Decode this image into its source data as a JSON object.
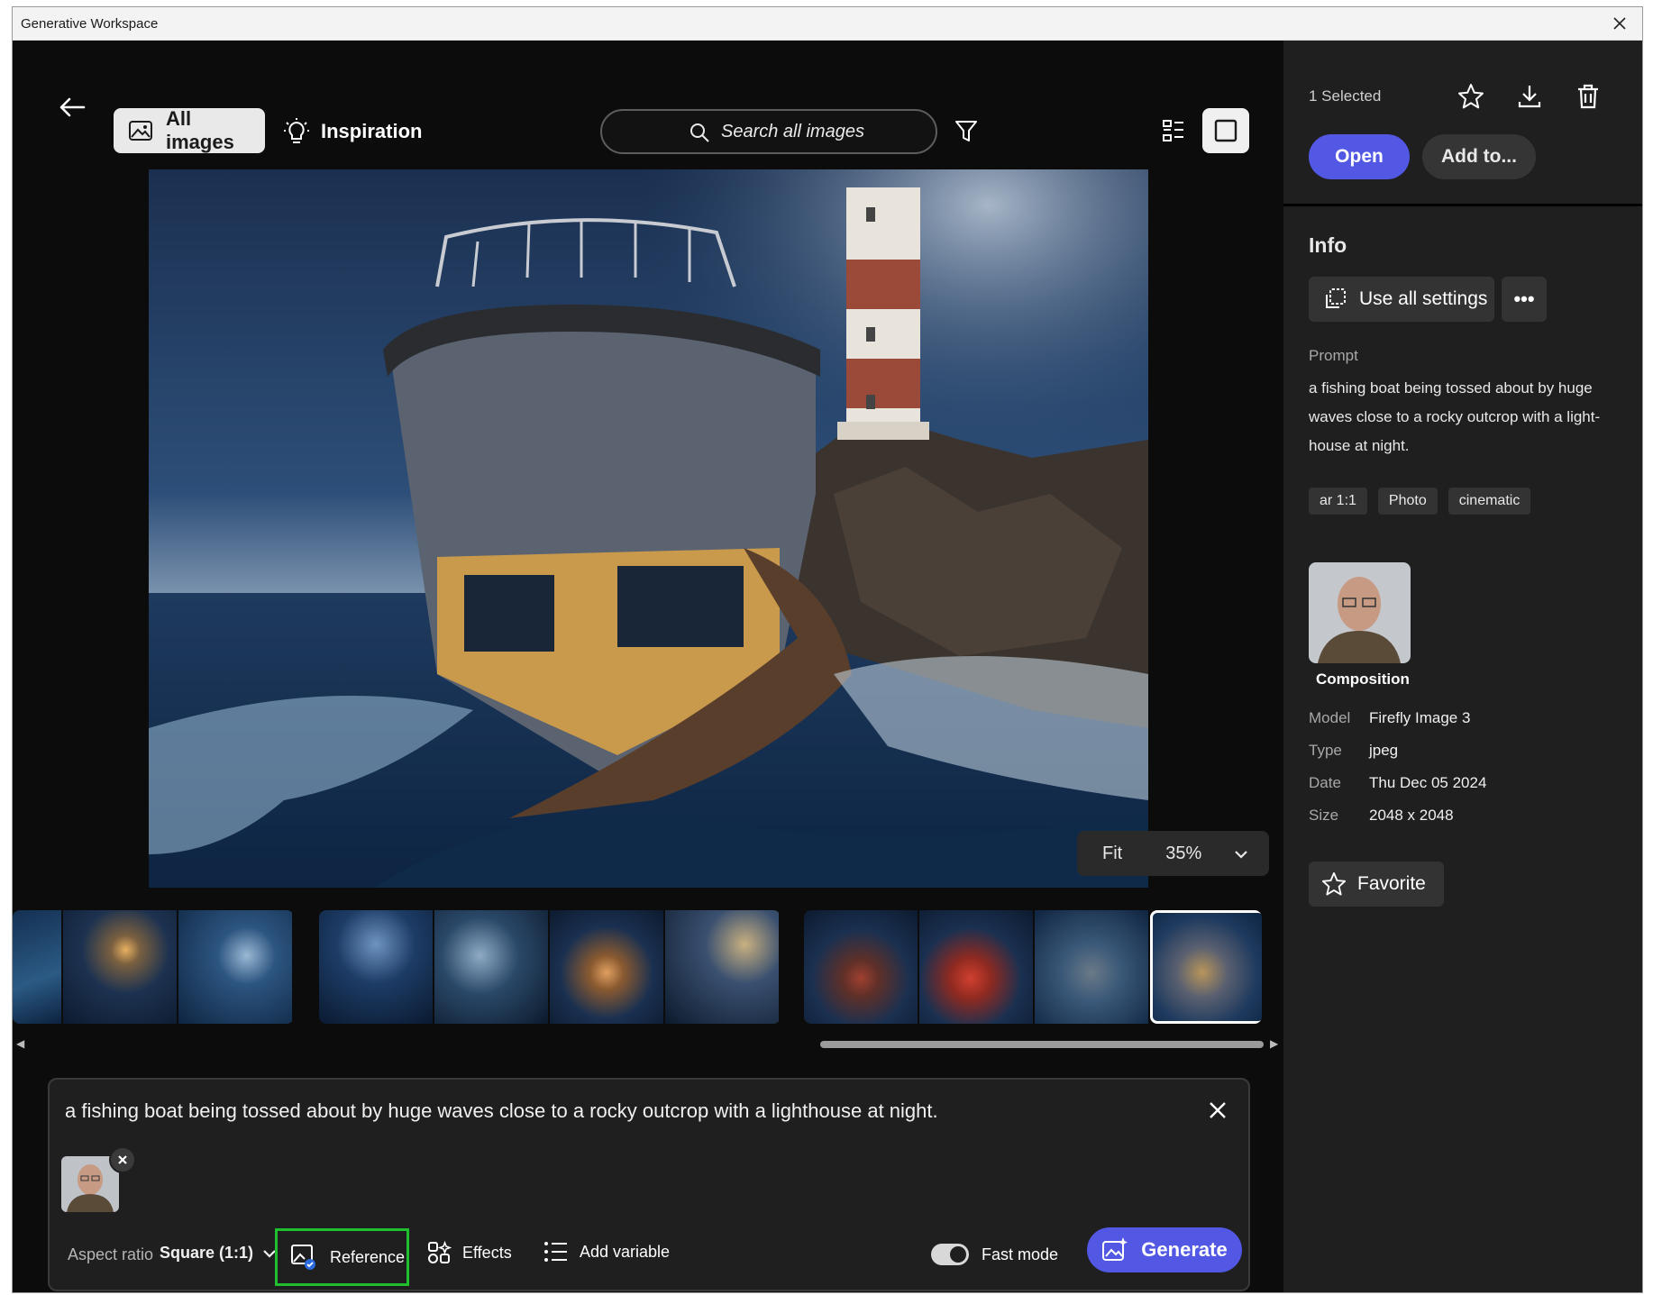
{
  "window": {
    "title": "Generative Workspace"
  },
  "topbar": {
    "all_images_label": "All images",
    "inspiration_label": "Inspiration",
    "search_placeholder": "Search all images"
  },
  "viewer": {
    "fit_label": "Fit",
    "zoom_value": "35%"
  },
  "thumbnails": {
    "groups": [
      {
        "count": 3
      },
      {
        "count": 4
      },
      {
        "count": 4,
        "selected_index": 3
      }
    ]
  },
  "prompt_bar": {
    "text": "a fishing boat being tossed about by huge waves close to a rocky outcrop with a lighthouse at night.",
    "aspect_ratio_label": "Aspect ratio",
    "aspect_ratio_value": "Square (1:1)",
    "reference_label": "Reference",
    "effects_label": "Effects",
    "add_variable_label": "Add variable",
    "fast_mode_label": "Fast mode",
    "fast_mode_on": true,
    "generate_label": "Generate"
  },
  "sidebar": {
    "selected_count": "1 Selected",
    "open_label": "Open",
    "add_to_label": "Add to...",
    "info_title": "Info",
    "use_all_settings_label": "Use all settings",
    "more_label": "•••",
    "prompt_label": "Prompt",
    "prompt_text": "a fishing boat being tossed about by huge waves close to a rocky outcrop with a light-house at night.",
    "tags": [
      "ar 1:1",
      "Photo",
      "cinematic"
    ],
    "composition_label": "Composition",
    "meta": [
      {
        "key": "Model",
        "value": "Firefly Image 3"
      },
      {
        "key": "Type",
        "value": "jpeg"
      },
      {
        "key": "Date",
        "value": "Thu Dec 05 2024"
      },
      {
        "key": "Size",
        "value": "2048 x 2048"
      }
    ],
    "favorite_label": "Favorite"
  },
  "colors": {
    "accent": "#5258e4",
    "reference_highlight": "#1fbf2e"
  }
}
